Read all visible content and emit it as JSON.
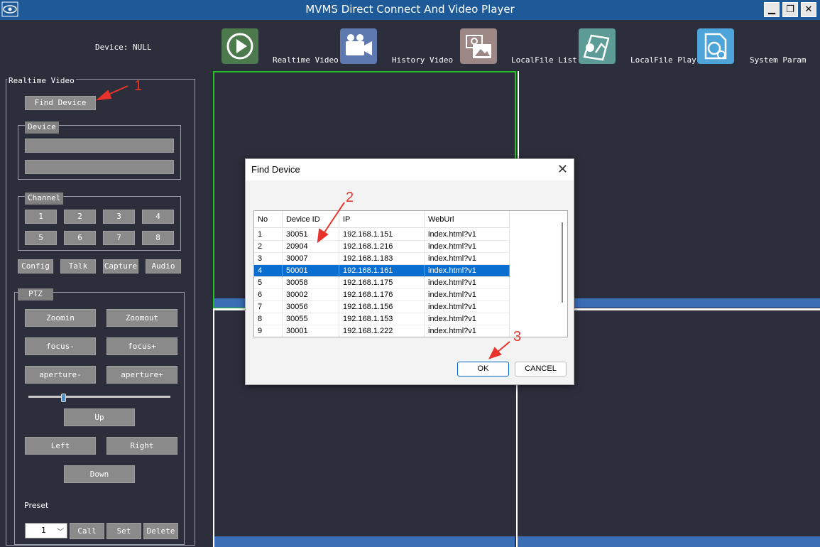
{
  "window": {
    "title": "MVMS Direct Connect And Video Player",
    "controls": {
      "minimize": "▁",
      "restore": "❐",
      "close": "✕"
    }
  },
  "toolbar": {
    "device_label": "Device: NULL",
    "items": [
      {
        "label": "Realtime Video",
        "icon": "play-icon",
        "color": "#4c7a4c"
      },
      {
        "label": "History Video",
        "icon": "camera-icon",
        "color": "#5d79b0"
      },
      {
        "label": "LocalFile List",
        "icon": "photo-folder-icon",
        "color": "#9c8784"
      },
      {
        "label": "LocalFile Play",
        "icon": "map-pin-icon",
        "color": "#5d9c96"
      },
      {
        "label": "System Param",
        "icon": "document-settings-icon",
        "color": "#4da4d8"
      }
    ]
  },
  "left_panel": {
    "group_title": "Realtime Video",
    "find_device": "Find Device",
    "device_group": "Device",
    "channel_group": "Channel",
    "channels": [
      "1",
      "2",
      "3",
      "4",
      "5",
      "6",
      "7",
      "8"
    ],
    "actions": [
      "Config",
      "Talk",
      "Capture",
      "Audio"
    ],
    "ptz_group": "PTZ",
    "ptz": {
      "zoomin": "Zoomin",
      "zoomout": "Zoomout",
      "focus_minus": "focus-",
      "focus_plus": "focus+",
      "aperture_minus": "aperture-",
      "aperture_plus": "aperture+",
      "up": "Up",
      "left": "Left",
      "right": "Right",
      "down": "Down"
    },
    "preset_label": "Preset",
    "preset_value": "1",
    "preset_buttons": [
      "Call",
      "Set",
      "Delete"
    ]
  },
  "dialog": {
    "title": "Find Device",
    "columns": [
      "No",
      "Device ID",
      "IP",
      "WebUrl"
    ],
    "rows": [
      [
        "1",
        "30051",
        "192.168.1.151",
        "index.html?v1"
      ],
      [
        "2",
        "20904",
        "192.168.1.216",
        "index.html?v1"
      ],
      [
        "3",
        "30007",
        "192.168.1.183",
        "index.html?v1"
      ],
      [
        "4",
        "50001",
        "192.168.1.161",
        "index.html?v1"
      ],
      [
        "5",
        "30058",
        "192.168.1.175",
        "index.html?v1"
      ],
      [
        "6",
        "30002",
        "192.168.1.176",
        "index.html?v1"
      ],
      [
        "7",
        "30056",
        "192.168.1.156",
        "index.html?v1"
      ],
      [
        "8",
        "30055",
        "192.168.1.153",
        "index.html?v1"
      ],
      [
        "9",
        "30001",
        "192.168.1.222",
        "index.html?v1"
      ]
    ],
    "selected_row": 4,
    "ok": "OK",
    "cancel": "CANCEL"
  },
  "annotations": {
    "step1": "1",
    "step2": "2",
    "step3": "3",
    "color": "#e8332c"
  },
  "colors": {
    "titlebar": "#1e5a98",
    "background": "#2c2e3b",
    "active_cell_border": "#22c322",
    "selection": "#0a6ed1"
  }
}
